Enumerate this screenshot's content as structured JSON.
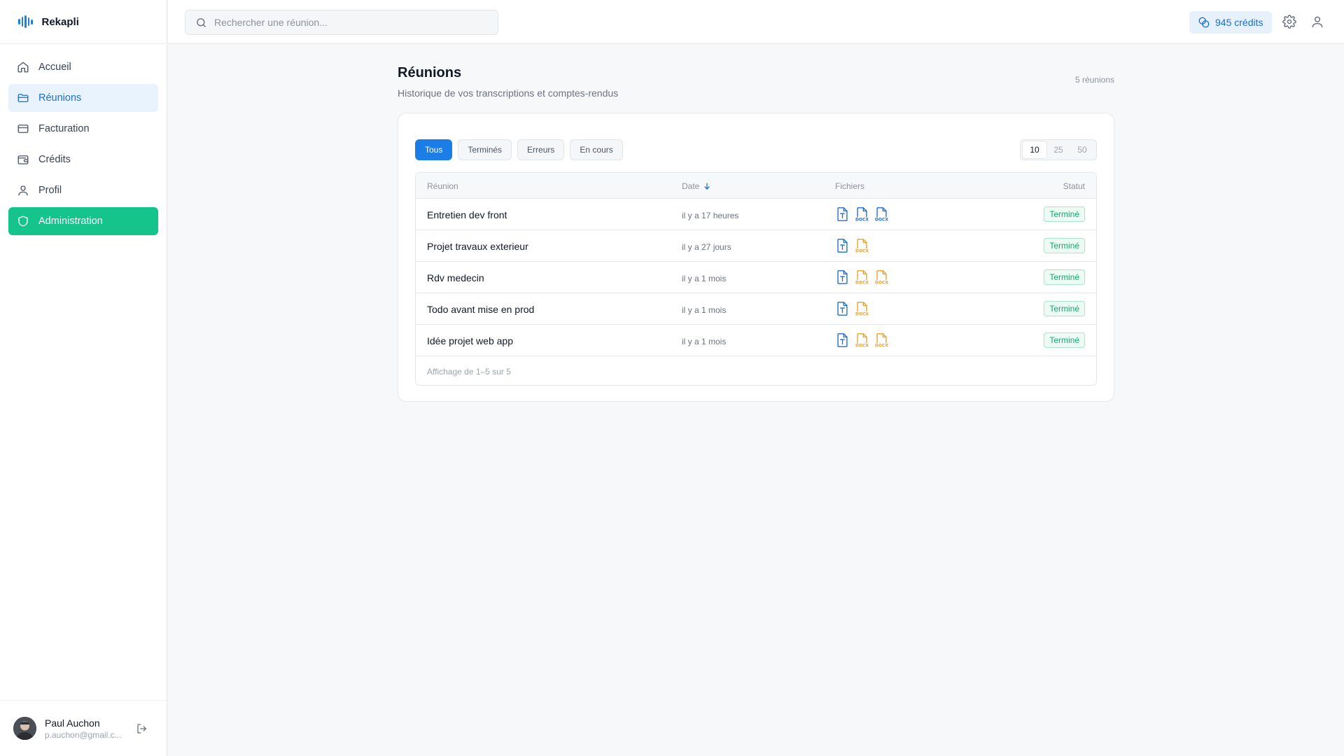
{
  "app": {
    "name": "Rekapli"
  },
  "sidebar": {
    "items": [
      {
        "label": "Accueil",
        "icon": "home-icon"
      },
      {
        "label": "Réunions",
        "icon": "folder-icon"
      },
      {
        "label": "Facturation",
        "icon": "credit-card-icon"
      },
      {
        "label": "Crédits",
        "icon": "wallet-icon"
      },
      {
        "label": "Profil",
        "icon": "user-icon"
      },
      {
        "label": "Administration",
        "icon": "shield-icon"
      }
    ],
    "user": {
      "name": "Paul Auchon",
      "email": "p.auchon@gmail.c..."
    }
  },
  "topbar": {
    "search_placeholder": "Rechercher une réunion...",
    "credits": "945 crédits"
  },
  "page": {
    "title": "Réunions",
    "subtitle": "Historique de vos transcriptions et comptes-rendus",
    "count": "5 réunions"
  },
  "filters": [
    "Tous",
    "Terminés",
    "Erreurs",
    "En cours"
  ],
  "page_sizes": [
    "10",
    "25",
    "50"
  ],
  "table": {
    "headers": {
      "name": "Réunion",
      "date": "Date",
      "files": "Fichiers",
      "status": "Statut"
    },
    "rows": [
      {
        "name": "Entretien dev front",
        "date": "il y a 17 heures",
        "status": "Terminé",
        "files": [
          "txt",
          "docx-blue",
          "docx-blue"
        ]
      },
      {
        "name": "Projet travaux exterieur",
        "date": "il y a 27 jours",
        "status": "Terminé",
        "files": [
          "txt",
          "docx-orange"
        ]
      },
      {
        "name": "Rdv medecin",
        "date": "il y a 1 mois",
        "status": "Terminé",
        "files": [
          "txt",
          "docx-orange",
          "docx-orange"
        ]
      },
      {
        "name": "Todo avant mise en prod",
        "date": "il y a 1 mois",
        "status": "Terminé",
        "files": [
          "txt",
          "docx-orange"
        ]
      },
      {
        "name": "Idée projet web app",
        "date": "il y a 1 mois",
        "status": "Terminé",
        "files": [
          "txt",
          "docx-orange",
          "docx-orange"
        ]
      }
    ],
    "footer": "Affichage de 1–5 sur 5"
  },
  "colors": {
    "accent": "#1a7ee6",
    "admin": "#14c48a",
    "docx_blue": "#1a6fd1",
    "docx_orange": "#f0a020",
    "success": "#12a873"
  }
}
